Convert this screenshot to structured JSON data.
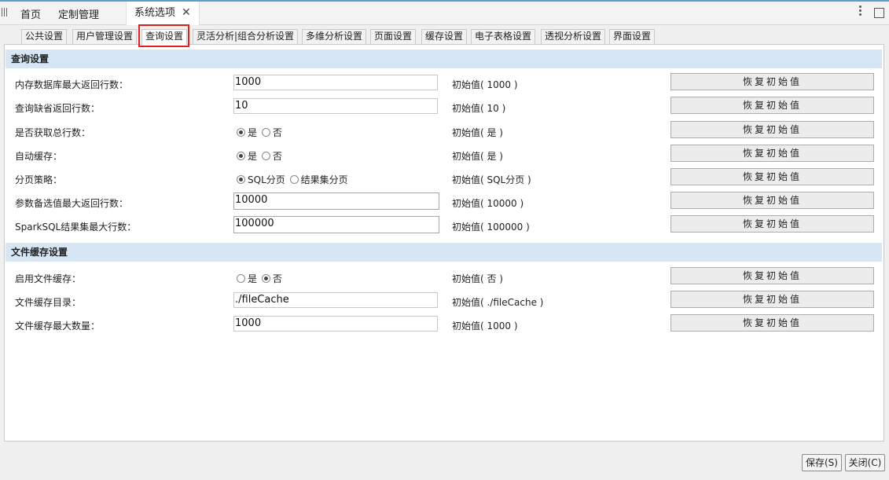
{
  "topbar": {
    "tabs": [
      {
        "label": "首页"
      },
      {
        "label": "定制管理"
      },
      {
        "label": "系统选项"
      }
    ],
    "close_glyph": "✕"
  },
  "subtabs": [
    {
      "label": "公共设置"
    },
    {
      "label": "用户管理设置"
    },
    {
      "label": "查询设置"
    },
    {
      "label": "灵活分析|组合分析设置"
    },
    {
      "label": "多维分析设置"
    },
    {
      "label": "页面设置"
    },
    {
      "label": "缓存设置"
    },
    {
      "label": "电子表格设置"
    },
    {
      "label": "透视分析设置"
    },
    {
      "label": "界面设置"
    }
  ],
  "active_subtab": "查询设置",
  "highlight_color": "#e0201e",
  "sections": {
    "query": {
      "title": "查询设置",
      "rows": [
        {
          "label": "内存数据库最大返回行数：",
          "value": "1000",
          "initial": "初始值( 1000 )",
          "restore": "恢复初始值"
        },
        {
          "label": "查询缺省返回行数：",
          "value": "10",
          "initial": "初始值( 10 )",
          "restore": "恢复初始值"
        },
        {
          "label": "是否获取总行数：",
          "options": [
            "是",
            "否"
          ],
          "selected": "是",
          "initial": "初始值( 是 )",
          "restore": "恢复初始值"
        },
        {
          "label": "自动缓存：",
          "options": [
            "是",
            "否"
          ],
          "selected": "是",
          "initial": "初始值( 是 )",
          "restore": "恢复初始值"
        },
        {
          "label": "分页策略：",
          "options": [
            "SQL分页",
            "结果集分页"
          ],
          "selected": "SQL分页",
          "initial": "初始值( SQL分页 )",
          "restore": "恢复初始值"
        },
        {
          "label": "参数备选值最大返回行数：",
          "value": "10000",
          "initial": "初始值( 10000 )",
          "restore": "恢复初始值"
        },
        {
          "label": "SparkSQL结果集最大行数：",
          "value": "100000",
          "initial": "初始值( 100000 )",
          "restore": "恢复初始值"
        }
      ]
    },
    "filecache": {
      "title": "文件缓存设置",
      "rows": [
        {
          "label": "启用文件缓存：",
          "options": [
            "是",
            "否"
          ],
          "selected": "否",
          "initial": "初始值( 否 )",
          "restore": "恢复初始值"
        },
        {
          "label": "文件缓存目录：",
          "value": "./fileCache",
          "initial": "初始值( ./fileCache )",
          "restore": "恢复初始值"
        },
        {
          "label": "文件缓存最大数量：",
          "value": "1000",
          "initial": "初始值( 1000 )",
          "restore": "恢复初始值"
        }
      ]
    }
  },
  "footer": {
    "save_label": "保存(S)",
    "close_label": "关闭(C)"
  }
}
